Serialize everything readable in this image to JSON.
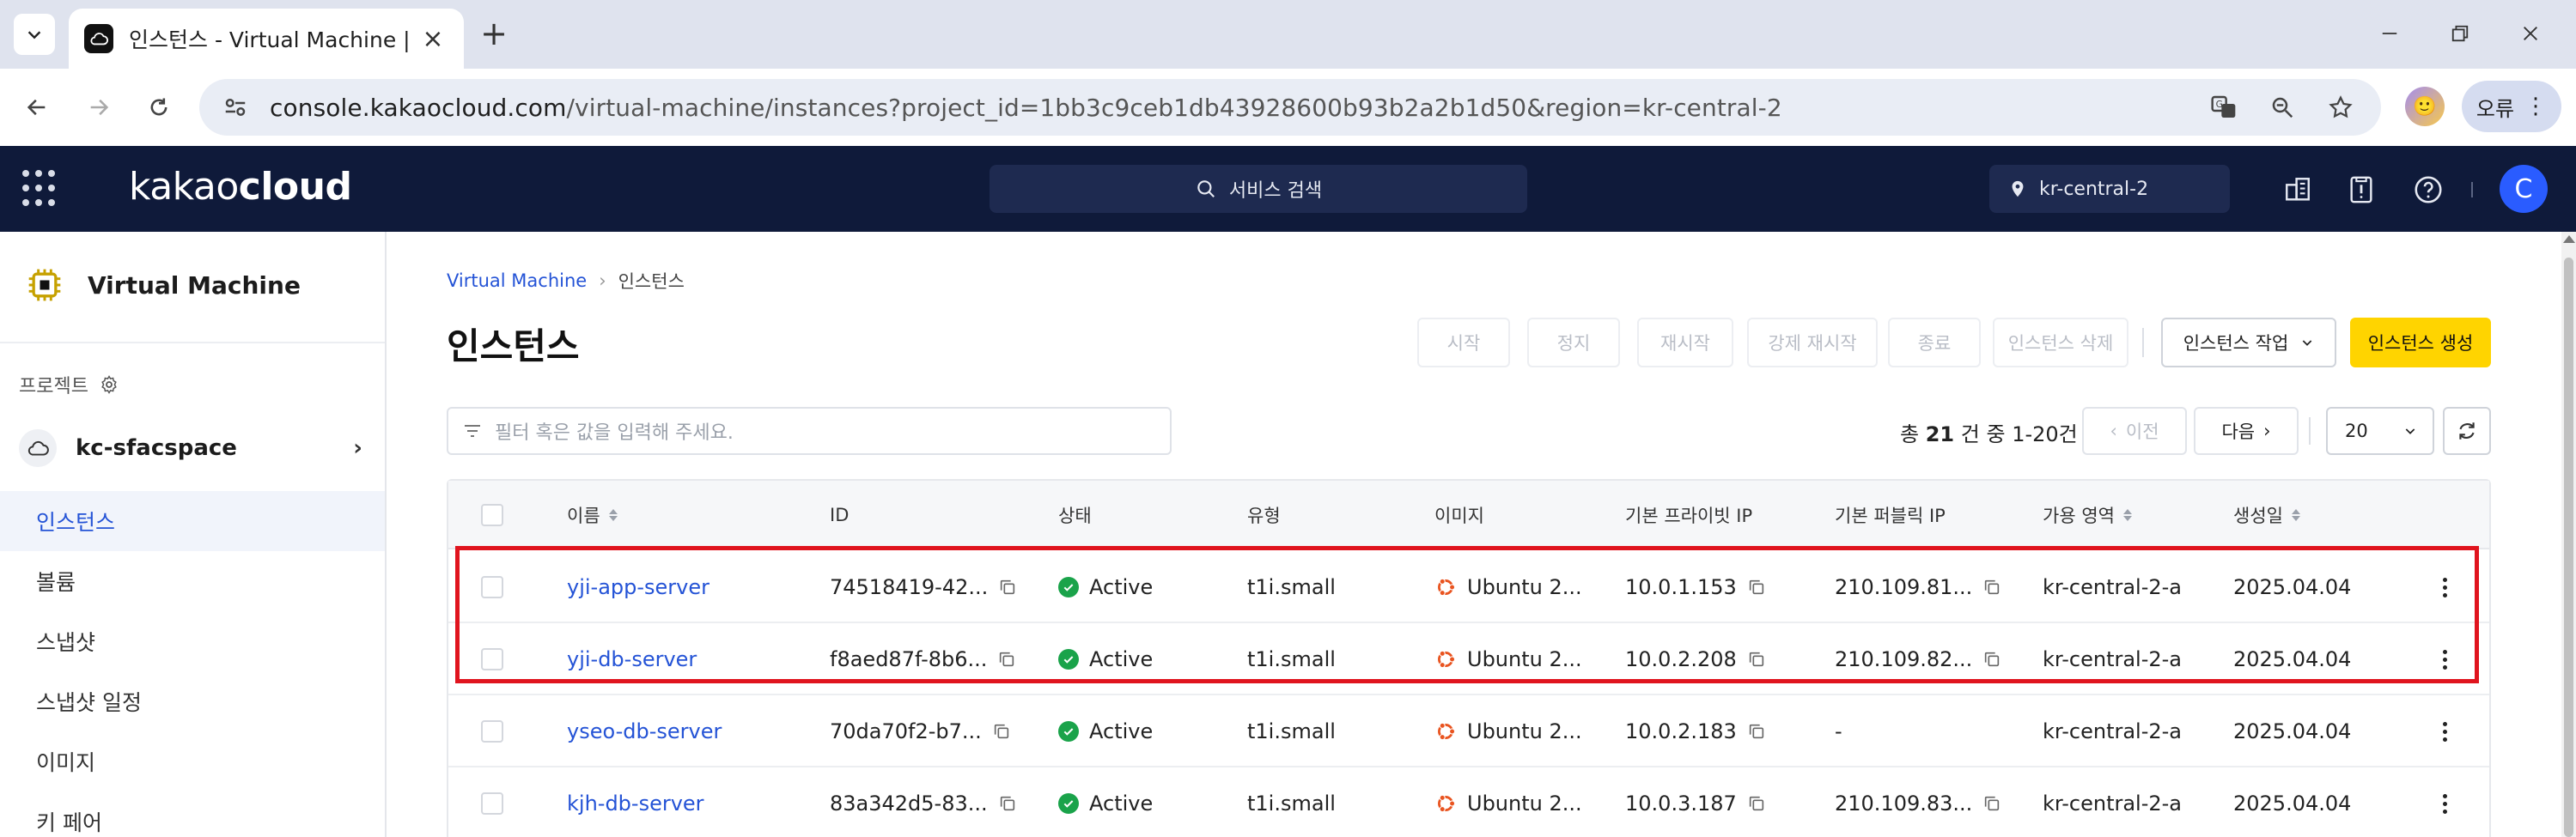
{
  "browser": {
    "tab_title": "인스턴스 - Virtual Machine | 카",
    "url_host": "console.kakaocloud.com",
    "url_path": "/virtual-machine/instances?project_id=1bb3c9ceb1db43928600b93b2a2b1d50&region=kr-central-2",
    "profile_button": "오류"
  },
  "header": {
    "logo_light": "kakao",
    "logo_bold": "cloud",
    "search_placeholder": "서비스 검색",
    "region": "kr-central-2",
    "user_initial": "C"
  },
  "sidebar": {
    "service_title": "Virtual Machine",
    "project_label": "프로젝트",
    "project_name": "kc-sfacspace",
    "items": [
      {
        "label": "인스턴스",
        "active": true
      },
      {
        "label": "볼륨"
      },
      {
        "label": "스냅샷"
      },
      {
        "label": "스냅샷 일정"
      },
      {
        "label": "이미지"
      },
      {
        "label": "키 페어"
      }
    ]
  },
  "main": {
    "breadcrumb_root": "Virtual Machine",
    "breadcrumb_current": "인스턴스",
    "title": "인스턴스",
    "actions": [
      "시작",
      "정지",
      "재시작",
      "강제 재시작",
      "종료",
      "인스턴스 삭제"
    ],
    "task_menu": "인스턴스 작업",
    "create_button": "인스턴스 생성",
    "filter_placeholder": "필터 혹은 값을 입력해 주세요.",
    "count_prefix": "총",
    "count_total": "21",
    "count_suffix": "건 중 1-20건",
    "prev": "이전",
    "next": "다음",
    "page_size": "20"
  },
  "table": {
    "columns": [
      "이름",
      "ID",
      "상태",
      "유형",
      "이미지",
      "기본 프라이빗 IP",
      "기본 퍼블릭 IP",
      "가용 영역",
      "생성일"
    ],
    "rows": [
      {
        "name": "yji-app-server",
        "id": "74518419-42...",
        "status": "Active",
        "type": "t1i.small",
        "image": "Ubuntu 2...",
        "private_ip": "10.0.1.153",
        "public_ip": "210.109.81...",
        "zone": "kr-central-2-a",
        "created": "2025.04.04"
      },
      {
        "name": "yji-db-server",
        "id": "f8aed87f-8b6...",
        "status": "Active",
        "type": "t1i.small",
        "image": "Ubuntu 2...",
        "private_ip": "10.0.2.208",
        "public_ip": "210.109.82...",
        "zone": "kr-central-2-a",
        "created": "2025.04.04"
      },
      {
        "name": "yseo-db-server",
        "id": "70da70f2-b7...",
        "status": "Active",
        "type": "t1i.small",
        "image": "Ubuntu 2...",
        "private_ip": "10.0.2.183",
        "public_ip": "-",
        "zone": "kr-central-2-a",
        "created": "2025.04.04"
      },
      {
        "name": "kjh-db-server",
        "id": "83a342d5-83...",
        "status": "Active",
        "type": "t1i.small",
        "image": "Ubuntu 2...",
        "private_ip": "10.0.3.187",
        "public_ip": "210.109.83...",
        "zone": "kr-central-2-a",
        "created": "2025.04.04"
      }
    ]
  },
  "colors": {
    "header_bg": "#0f1a3a",
    "accent_link": "#2453d6",
    "create_button": "#ffd400",
    "status_active": "#1aa34a",
    "highlight_box": "#e0141e"
  }
}
